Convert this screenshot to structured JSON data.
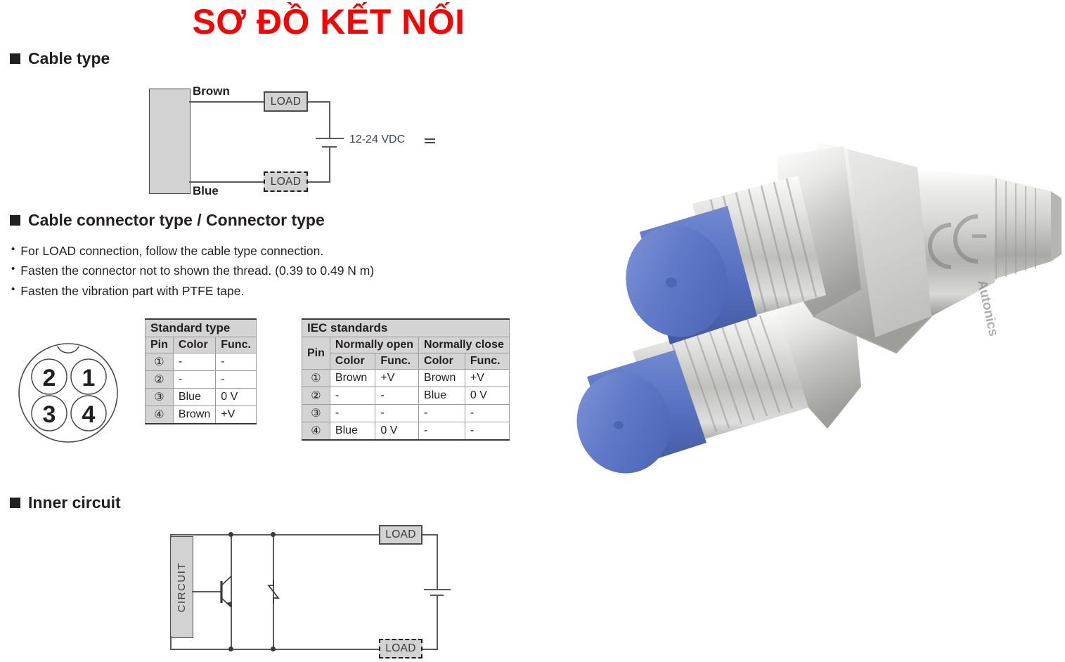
{
  "title": "SƠ ĐỒ KẾT NỐI",
  "sections": {
    "cable_type": "Cable type",
    "cable_connector_type": "Cable connector type / Connector type",
    "inner_circuit": "Inner circuit"
  },
  "cable_diagram": {
    "brown_label": "Brown",
    "blue_label": "Blue",
    "load_solid": "LOAD",
    "load_dashed": "LOAD",
    "supply_label": "12-24 VDC"
  },
  "notes": [
    "For LOAD connection, follow the cable type connection.",
    "Fasten the connector not to shown the thread.  (0.39 to 0.49 N m)",
    "Fasten the vibration part with PTFE tape."
  ],
  "pin_face": {
    "pins": [
      "2",
      "1",
      "3",
      "4"
    ]
  },
  "standard_table": {
    "caption": "Standard type",
    "headers": [
      "Pin",
      "Color",
      "Func."
    ],
    "rows": [
      {
        "pin": "①",
        "color": "-",
        "func": "-"
      },
      {
        "pin": "②",
        "color": "-",
        "func": "-"
      },
      {
        "pin": "③",
        "color": "Blue",
        "func": "0 V"
      },
      {
        "pin": "④",
        "color": "Brown",
        "func": "+V"
      }
    ]
  },
  "iec_table": {
    "caption": "IEC standards",
    "pin_header": "Pin",
    "group_headers": [
      "Normally open",
      "Normally close"
    ],
    "sub_headers": [
      "Color",
      "Func.",
      "Color",
      "Func."
    ],
    "rows": [
      {
        "pin": "①",
        "no_color": "Brown",
        "no_func": "+V",
        "nc_color": "Brown",
        "nc_func": "+V"
      },
      {
        "pin": "②",
        "no_color": "-",
        "no_func": "-",
        "nc_color": "Blue",
        "nc_func": "0 V"
      },
      {
        "pin": "③",
        "no_color": "-",
        "no_func": "-",
        "nc_color": "-",
        "nc_func": "-"
      },
      {
        "pin": "④",
        "no_color": "Blue",
        "no_func": "0 V",
        "nc_color": "-",
        "nc_func": "-"
      }
    ]
  },
  "inner_circuit": {
    "circuit_label": "CIRCUIT",
    "zener_label": "Z",
    "load_solid": "LOAD",
    "load_dashed": "LOAD"
  },
  "photo": {
    "alt": "proximity-sensor-pair",
    "brand": "Autonics",
    "mark": "CE",
    "colors": {
      "sensor_face": "#6079c8",
      "sensor_face_shadow": "#4f67b4",
      "metal_light": "#f2f2f0",
      "metal_mid": "#c9c9c7",
      "metal_dark": "#8e8e8c"
    }
  },
  "colors": {
    "title_red": "#ff0000",
    "ink": "#231f20",
    "panel_gray": "#d2d2d2",
    "table_header_gray": "#d4d4d4",
    "wire_gray": "#5a5a5a"
  }
}
